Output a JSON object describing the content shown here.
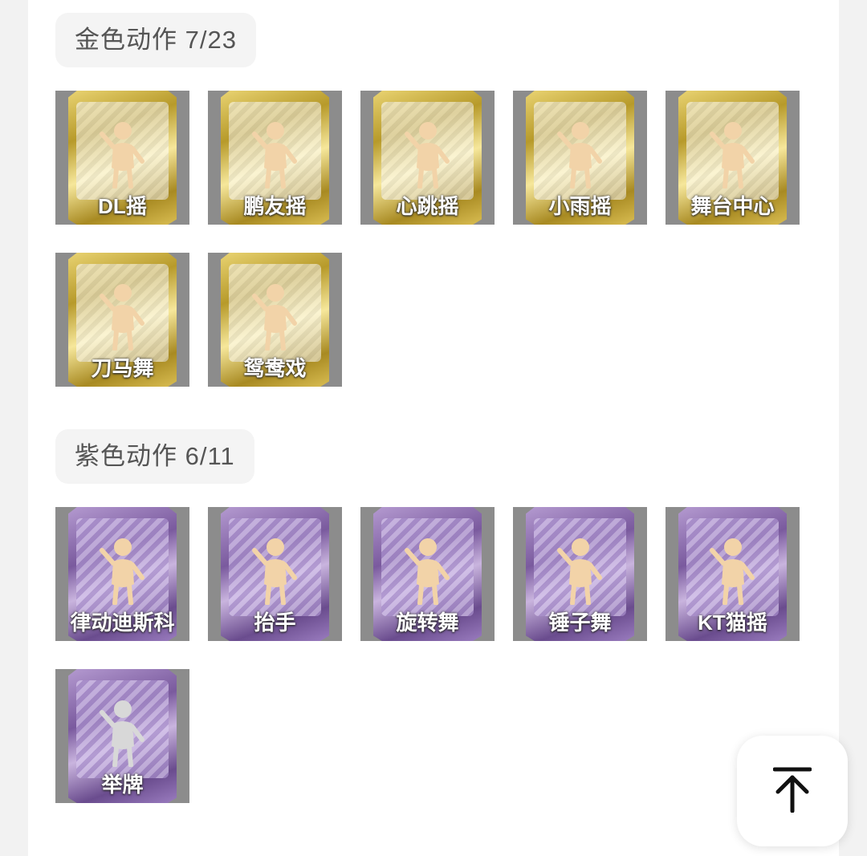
{
  "sections": [
    {
      "title": "金色动作 7/23",
      "rarity": "gold",
      "items": [
        {
          "label": "DL摇",
          "icon": "dance-figure-icon"
        },
        {
          "label": "鹏友摇",
          "icon": "dance-figure-icon"
        },
        {
          "label": "心跳摇",
          "icon": "dance-figure-icon"
        },
        {
          "label": "小雨摇",
          "icon": "dance-figure-icon"
        },
        {
          "label": "舞台中心",
          "icon": "dance-figure-icon"
        },
        {
          "label": "刀马舞",
          "icon": "dance-figure-icon"
        },
        {
          "label": "鸳鸯戏",
          "icon": "dance-figure-icon"
        }
      ]
    },
    {
      "title": "紫色动作 6/11",
      "rarity": "purple",
      "items": [
        {
          "label": "律动迪斯科",
          "icon": "dance-figure-icon"
        },
        {
          "label": "抬手",
          "icon": "dance-figure-icon"
        },
        {
          "label": "旋转舞",
          "icon": "dance-figure-icon"
        },
        {
          "label": "锤子舞",
          "icon": "dance-figure-icon"
        },
        {
          "label": "KT猫摇",
          "icon": "dance-figure-icon"
        },
        {
          "label": "举牌",
          "icon": "sign-holding-icon"
        }
      ]
    }
  ],
  "back_to_top": {
    "icon": "arrow-up-to-line-icon"
  },
  "colors": {
    "gold": "#c9ab3a",
    "purple": "#8b6bb0",
    "background": "#f2f2f2",
    "card_bg": "#8c8c8c"
  }
}
